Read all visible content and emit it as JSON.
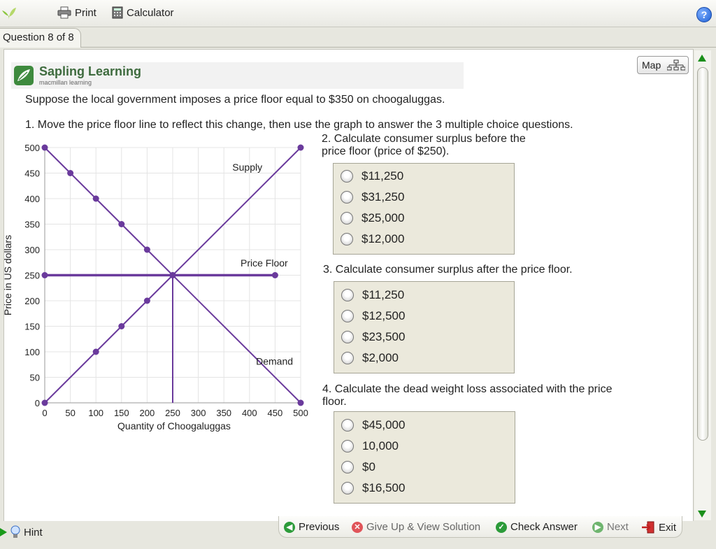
{
  "toolbar": {
    "print_label": "Print",
    "calculator_label": "Calculator"
  },
  "question_tab": "Question 8 of 8",
  "logo": {
    "name": "Sapling Learning",
    "tagline": "macmillan learning"
  },
  "map_label": "Map",
  "question_text": "Suppose the local government imposes a price floor equal to $350 on choogaluggas.",
  "instruction_1": "1. Move the price floor line to reflect this change, then use the graph to answer the 3 multiple choice questions.",
  "q2": {
    "line1": "2. Calculate consumer surplus before the",
    "line2": "price floor (price of $250).",
    "choices": [
      "$11,250",
      "$31,250",
      "$25,000",
      "$12,000"
    ]
  },
  "q3": {
    "text": "3. Calculate consumer surplus after the price floor.",
    "choices": [
      "$11,250",
      "$12,500",
      "$23,500",
      "$2,000"
    ]
  },
  "q4": {
    "line1": "4. Calculate the dead weight loss associated with the price",
    "line2": "floor.",
    "choices": [
      "$45,000",
      "10,000",
      "$0",
      "$16,500"
    ]
  },
  "chart_data": {
    "type": "line",
    "xlabel": "Quantity of Choogaluggas",
    "ylabel": "Price in US dollars",
    "xlim": [
      0,
      500
    ],
    "ylim": [
      0,
      500
    ],
    "xticks": [
      0,
      50,
      100,
      150,
      200,
      250,
      300,
      350,
      400,
      450,
      500
    ],
    "yticks": [
      0,
      50,
      100,
      150,
      200,
      250,
      300,
      350,
      400,
      450,
      500
    ],
    "grid": true,
    "color": "#6a3a9c",
    "series": [
      {
        "name": "Supply",
        "points": [
          [
            0,
            0
          ],
          [
            100,
            100
          ],
          [
            150,
            150
          ],
          [
            200,
            200
          ],
          [
            250,
            250
          ],
          [
            500,
            500
          ]
        ]
      },
      {
        "name": "Demand",
        "points": [
          [
            0,
            500
          ],
          [
            50,
            450
          ],
          [
            100,
            400
          ],
          [
            150,
            350
          ],
          [
            200,
            300
          ],
          [
            250,
            250
          ],
          [
            500,
            0
          ]
        ]
      },
      {
        "name": "Price Floor",
        "points": [
          [
            0,
            250
          ],
          [
            450,
            250
          ]
        ]
      },
      {
        "name": "",
        "points": [
          [
            250,
            0
          ],
          [
            250,
            250
          ]
        ]
      }
    ],
    "labels": [
      {
        "text": "Supply",
        "x": 425,
        "y": 455
      },
      {
        "text": "Price Floor",
        "x": 475,
        "y": 267
      },
      {
        "text": "Demand",
        "x": 485,
        "y": 75
      }
    ]
  },
  "nav": {
    "hint": "Hint",
    "previous": "Previous",
    "giveup": "Give Up & View Solution",
    "check": "Check Answer",
    "next": "Next",
    "exit": "Exit"
  }
}
